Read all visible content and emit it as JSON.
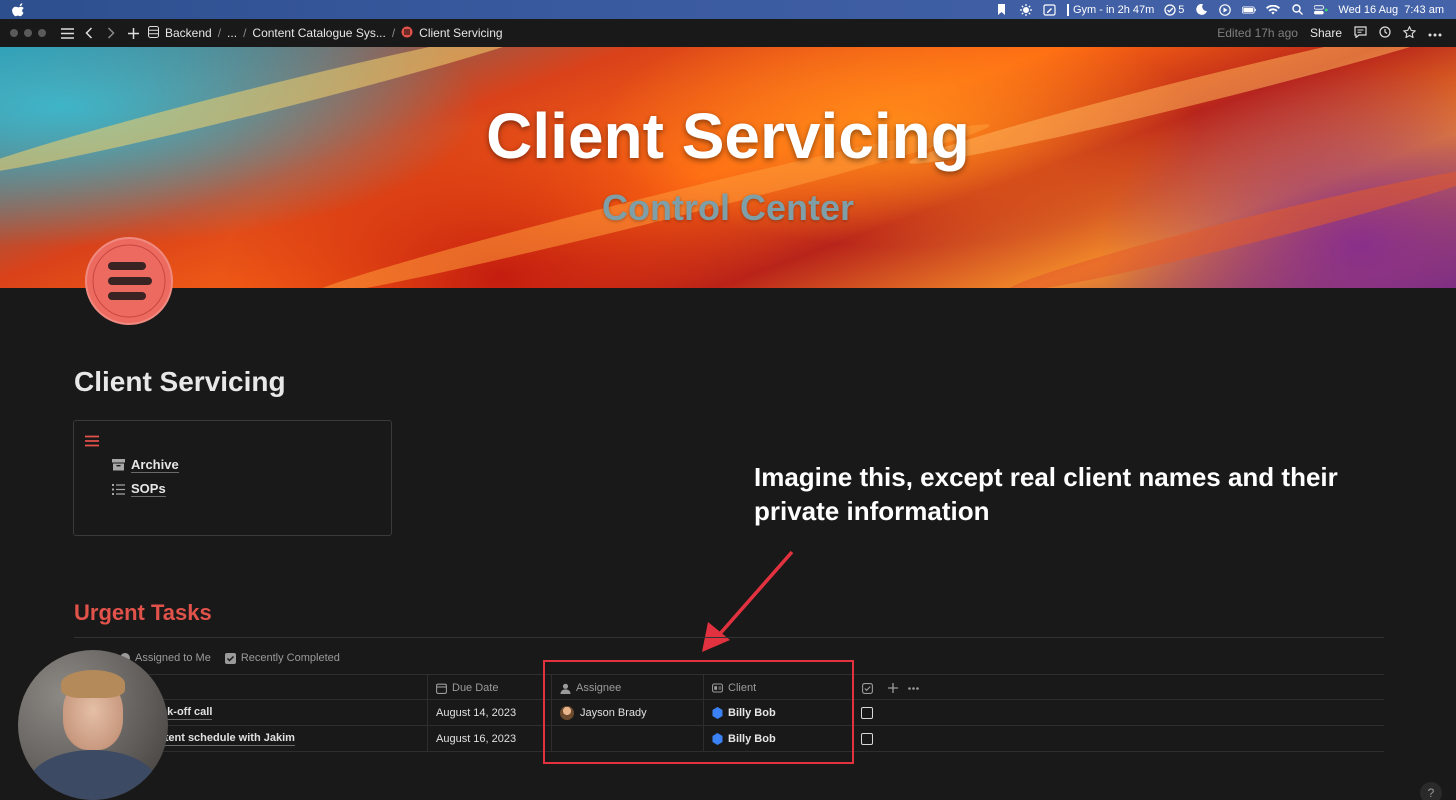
{
  "menubar": {
    "calendar_event": "Gym - in 2h 47m",
    "tasks_count": "5",
    "datetime": "Wed 16 Aug  7:43 am"
  },
  "topbar": {
    "breadcrumbs": [
      "Backend",
      "...",
      "Content Catalogue Sys...",
      "Client Servicing"
    ],
    "edited": "Edited 17h ago",
    "share": "Share"
  },
  "cover": {
    "title": "Client Servicing",
    "subtitle": "Control Center"
  },
  "page": {
    "title": "Client Servicing",
    "toc_items": [
      "Archive",
      "SOPs"
    ]
  },
  "annotation": "Imagine this, except real client names and their private information",
  "section": {
    "title": "Urgent Tasks",
    "views": [
      "Assigned to Me",
      "Recently Completed"
    ]
  },
  "table": {
    "columns": [
      "Due Date",
      "Assignee",
      "Client"
    ],
    "rows": [
      {
        "name": "ick-off call",
        "due": "August 14, 2023",
        "assignee": "Jayson Brady",
        "client": "Billy Bob"
      },
      {
        "name": "ntent schedule with Jakim",
        "due": "August 16, 2023",
        "assignee": "",
        "client": "Billy Bob"
      }
    ]
  },
  "help": "?",
  "colors": {
    "accent_red": "#e0524a",
    "highlight_box": "#e3323f",
    "client_hex_icon": "#3b82f6"
  }
}
